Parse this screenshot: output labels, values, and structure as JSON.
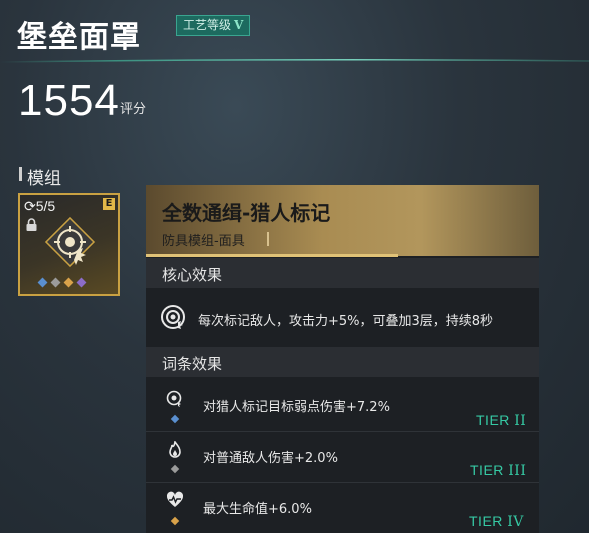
{
  "header": {
    "title": "堡垒面罩",
    "craft_level_label": "工艺等级",
    "craft_level_value": "V",
    "score": "1554",
    "score_unit": "评分"
  },
  "module_section": {
    "label": "模组",
    "card": {
      "uses": "5/5",
      "grade": "E",
      "gem_colors": [
        "#5a8fd0",
        "#9b9b9b",
        "#d9a24a",
        "#8c6cc8"
      ]
    }
  },
  "tooltip": {
    "title": "全数通缉-猎人标记",
    "subtitle": "防具模组-面具",
    "core_section_label": "核心效果",
    "core_effect": "每次标记敌人，攻击力+5%，可叠加3层，持续8秒",
    "affix_section_label": "词条效果",
    "affixes": [
      {
        "icon": "crosshair-mark-icon",
        "text": "对猎人标记目标弱点伤害+7.2%",
        "tier_label": "TIER",
        "tier_numeral": "II",
        "dot_color": "#5a8fd0"
      },
      {
        "icon": "flame-icon",
        "text": "对普通敌人伤害+2.0%",
        "tier_label": "TIER",
        "tier_numeral": "III",
        "dot_color": "#9b9b9b"
      },
      {
        "icon": "heart-pulse-icon",
        "text": "最大生命值+6.0%",
        "tier_label": "TIER",
        "tier_numeral": "IV",
        "dot_color": "#d9a24a"
      }
    ]
  }
}
